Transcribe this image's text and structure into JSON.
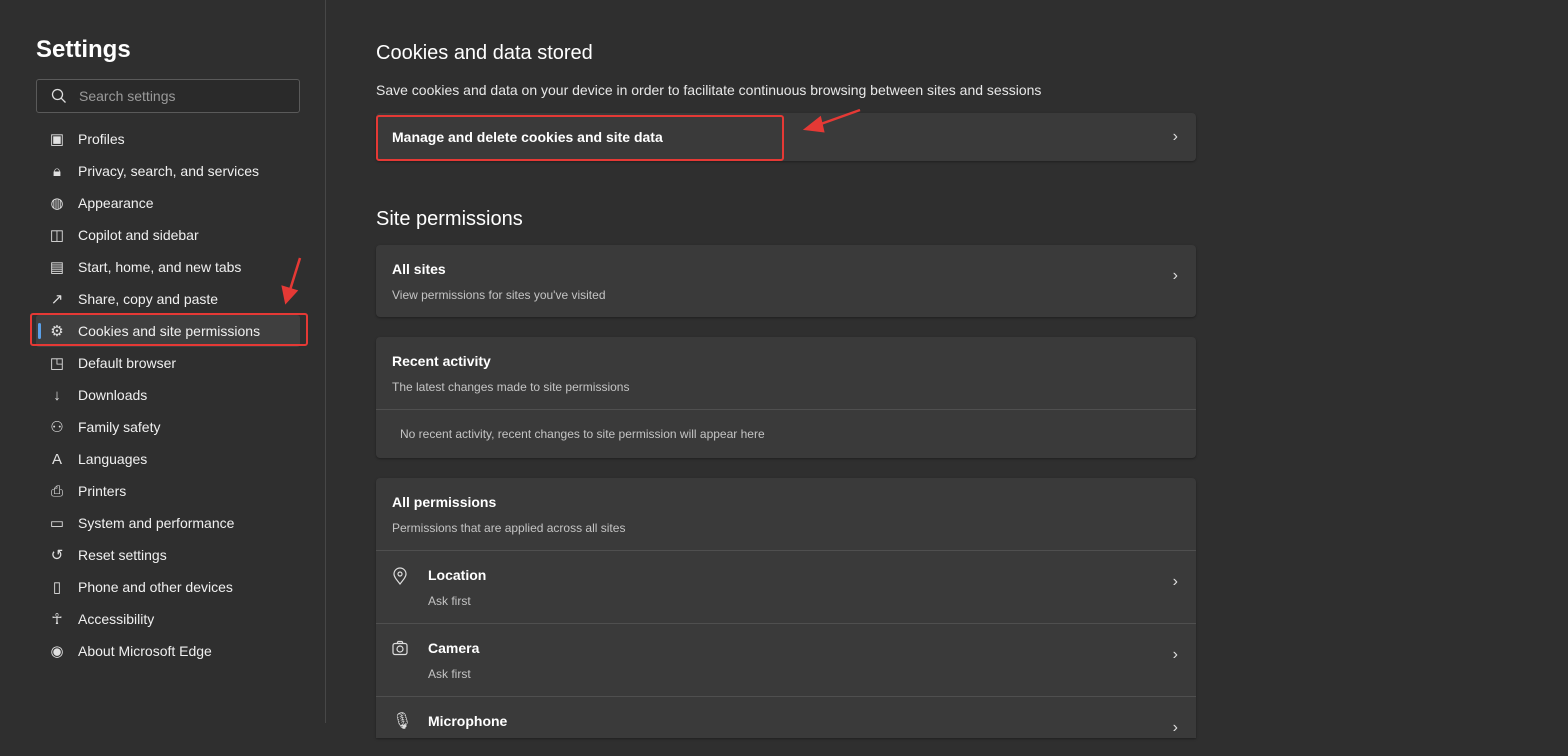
{
  "sidebar": {
    "title": "Settings",
    "search_placeholder": "Search settings",
    "items": [
      {
        "label": "Profiles",
        "icon": "profile-icon"
      },
      {
        "label": "Privacy, search, and services",
        "icon": "lock-icon"
      },
      {
        "label": "Appearance",
        "icon": "palette-icon"
      },
      {
        "label": "Copilot and sidebar",
        "icon": "sidebar-icon"
      },
      {
        "label": "Start, home, and new tabs",
        "icon": "home-tabs-icon"
      },
      {
        "label": "Share, copy and paste",
        "icon": "share-icon"
      },
      {
        "label": "Cookies and site permissions",
        "icon": "cookies-icon",
        "active": true
      },
      {
        "label": "Default browser",
        "icon": "default-browser-icon"
      },
      {
        "label": "Downloads",
        "icon": "download-icon"
      },
      {
        "label": "Family safety",
        "icon": "family-icon"
      },
      {
        "label": "Languages",
        "icon": "languages-icon"
      },
      {
        "label": "Printers",
        "icon": "printer-icon"
      },
      {
        "label": "System and performance",
        "icon": "laptop-icon"
      },
      {
        "label": "Reset settings",
        "icon": "reset-icon"
      },
      {
        "label": "Phone and other devices",
        "icon": "phone-icon"
      },
      {
        "label": "Accessibility",
        "icon": "accessibility-icon"
      },
      {
        "label": "About Microsoft Edge",
        "icon": "edge-icon"
      }
    ]
  },
  "cookies": {
    "heading": "Cookies and data stored",
    "description": "Save cookies and data on your device in order to facilitate continuous browsing between sites and sessions",
    "manage_label": "Manage and delete cookies and site data"
  },
  "site_permissions": {
    "heading": "Site permissions",
    "all_sites": {
      "title": "All sites",
      "subtitle": "View permissions for sites you've visited"
    },
    "recent": {
      "title": "Recent activity",
      "subtitle": "The latest changes made to site permissions",
      "empty": "No recent activity, recent changes to site permission will appear here"
    },
    "all_permissions": {
      "title": "All permissions",
      "subtitle": "Permissions that are applied across all sites",
      "items": [
        {
          "title": "Location",
          "value": "Ask first",
          "icon": "location-icon"
        },
        {
          "title": "Camera",
          "value": "Ask first",
          "icon": "camera-icon"
        },
        {
          "title": "Microphone",
          "icon": "microphone-icon"
        }
      ]
    }
  },
  "colors": {
    "accent": "#5aa0e8",
    "annotation": "#e53935"
  }
}
